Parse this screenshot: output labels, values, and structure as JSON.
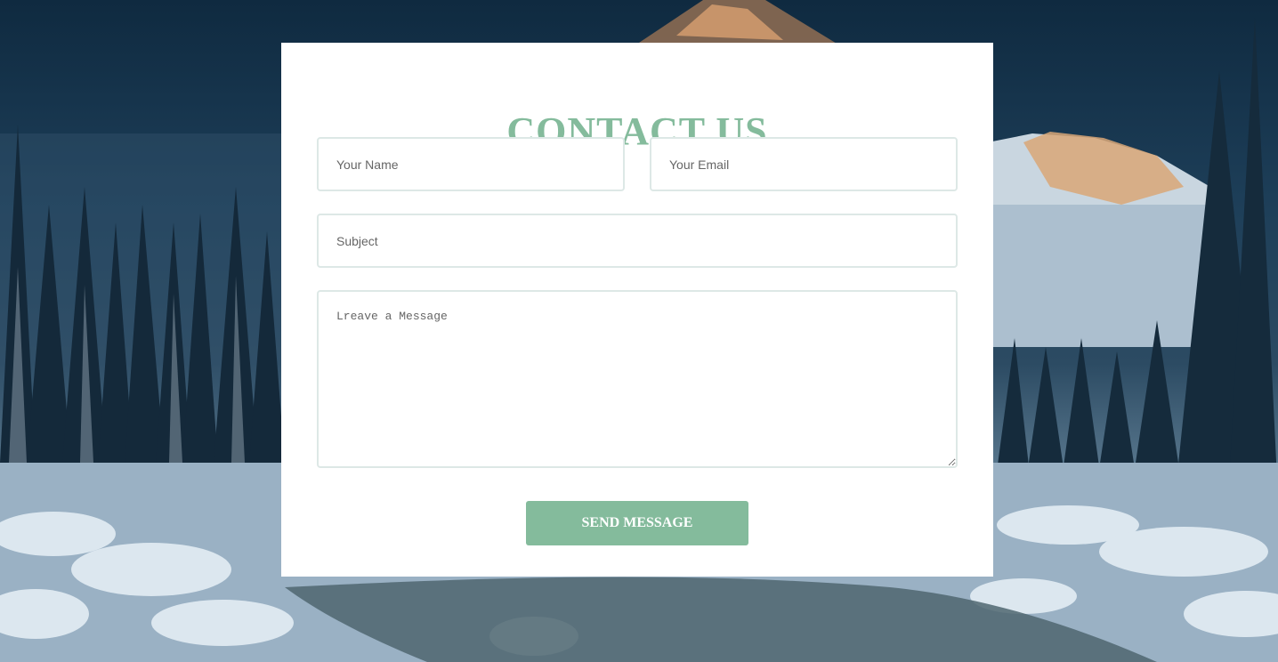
{
  "theme": {
    "accent": "#84bb9c",
    "card_bg": "#ffffff",
    "field_border": "#dde8e6"
  },
  "contact": {
    "title": "CONTACT US",
    "name_placeholder": "Your Name",
    "email_placeholder": "Your Email",
    "subject_placeholder": "Subject",
    "message_placeholder": "Lreave a Message",
    "send_label": "SEND MESSAGE"
  }
}
